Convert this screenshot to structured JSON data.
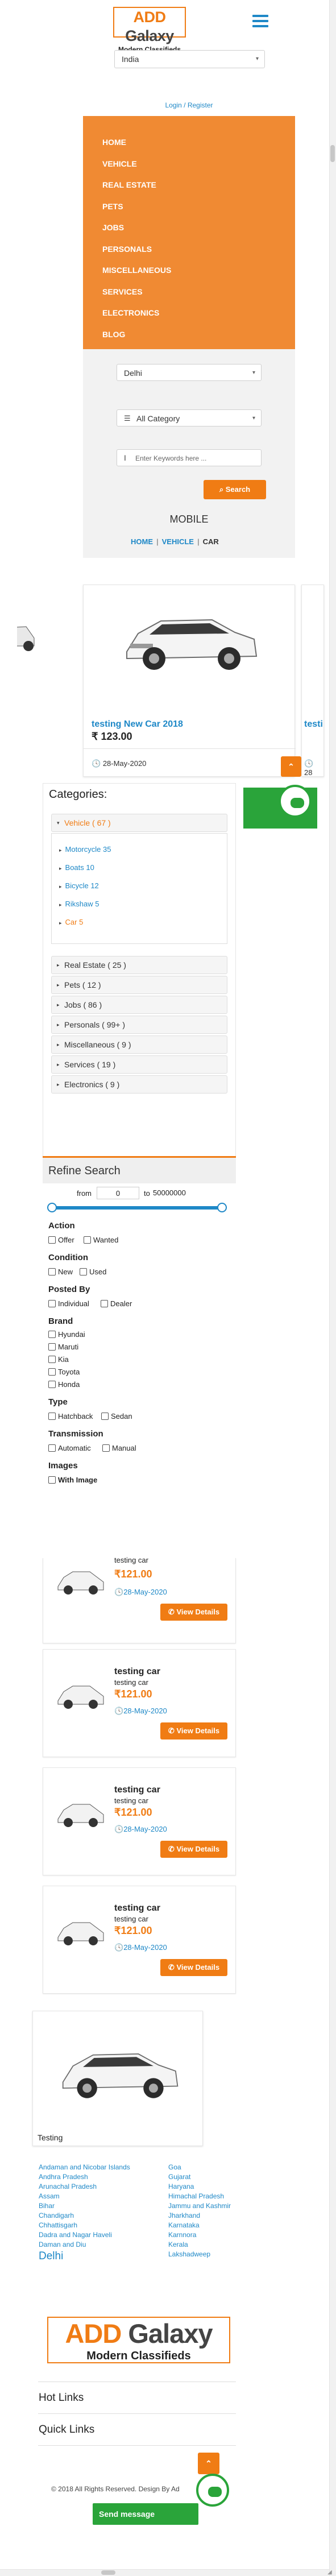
{
  "brand": {
    "logo_add": "ADD",
    "logo_galaxy": "Galaxy",
    "tagline": "Modern Classifieds"
  },
  "header": {
    "country_select": "India",
    "login_register": "Login / Register"
  },
  "menu": {
    "items": [
      "HOME",
      "VEHICLE",
      "REAL ESTATE",
      "PETS",
      "JOBS",
      "PERSONALS",
      "MISCELLANEOUS",
      "SERVICES",
      "ELECTRONICS",
      "BLOG"
    ]
  },
  "search": {
    "city_select": "Delhi",
    "category_select": "All Category",
    "keyword_placeholder": "Enter Keywords here ...",
    "search_button": "Search"
  },
  "breadcrumb": {
    "page_title": "MOBILE",
    "items": [
      "HOME",
      "VEHICLE",
      "CAR"
    ]
  },
  "carousel": {
    "title": "testing New Car 2018",
    "price": "₹ 123.00",
    "date": "28-May-2020",
    "partial_title": "testi",
    "partial_date": "28"
  },
  "categories": {
    "title": "Categories:",
    "vehicle": "Vehicle ( 67 )",
    "subcategories": [
      "Motorcycle 35",
      "Boats 10",
      "Bicycle 12",
      "Rikshaw 5",
      "Car 5"
    ],
    "items": [
      "Real Estate ( 25 )",
      "Pets ( 12 )",
      "Jobs ( 86 )",
      "Personals ( 99+ )",
      "Miscellaneous ( 9 )",
      "Services ( 19 )",
      "Electronics ( 9 )"
    ]
  },
  "refine": {
    "title": "Refine Search",
    "from_label": "from",
    "from_value": "0",
    "to_label": "to",
    "to_value": "50000000",
    "action": {
      "title": "Action",
      "options": [
        "Offer",
        "Wanted"
      ]
    },
    "condition": {
      "title": "Condition",
      "options": [
        "New",
        "Used"
      ]
    },
    "posted_by": {
      "title": "Posted By",
      "options": [
        "Individual",
        "Dealer"
      ]
    },
    "brand": {
      "title": "Brand",
      "options": [
        "Hyundai",
        "Maruti",
        "Kia",
        "Toyota",
        "Honda"
      ]
    },
    "type": {
      "title": "Type",
      "options": [
        "Hatchback",
        "Sedan"
      ]
    },
    "transmission": {
      "title": "Transmission",
      "options": [
        "Automatic",
        "Manual"
      ]
    },
    "images": {
      "title": "Images",
      "options": [
        "With Image"
      ]
    }
  },
  "listings": [
    {
      "title": "testing car",
      "subtitle": "testing car",
      "price": "₹121.00",
      "date": "28-May-2020",
      "button": "View Details"
    },
    {
      "title": "testing car",
      "subtitle": "testing car",
      "price": "₹121.00",
      "date": "28-May-2020",
      "button": "View Details"
    },
    {
      "title": "testing car",
      "subtitle": "testing car",
      "price": "₹121.00",
      "date": "28-May-2020",
      "button": "View Details"
    },
    {
      "title": "testing car",
      "subtitle": "testing car",
      "price": "₹121.00",
      "date": "28-May-2020",
      "button": "View Details"
    }
  ],
  "featured": {
    "caption": "Testing"
  },
  "footer": {
    "states_left": [
      "Andaman and Nicobar Islands",
      "Andhra Pradesh",
      "Arunachal Pradesh",
      "Assam",
      "Bihar",
      "Chandigarh",
      "Chhattisgarh",
      "Dadra and Nagar Haveli",
      "Daman and Diu"
    ],
    "states_right": [
      "Goa",
      "Gujarat",
      "Haryana",
      "Himachal Pradesh",
      "Jammu and Kashmir",
      "Jharkhand",
      "Karnataka",
      "Karnnora",
      "Kerala",
      "Lakshadweep"
    ],
    "city": "Delhi",
    "hot_links": "Hot Links",
    "quick_links": "Quick Links",
    "copyright": "© 2018 All Rights Reserved. Design By Ad",
    "send_message": "Send message"
  },
  "colors": {
    "accent": "#f07c14",
    "menu_bg": "#f08a33",
    "link": "#1e88c7",
    "whatsapp_green": "#2aa43a"
  }
}
